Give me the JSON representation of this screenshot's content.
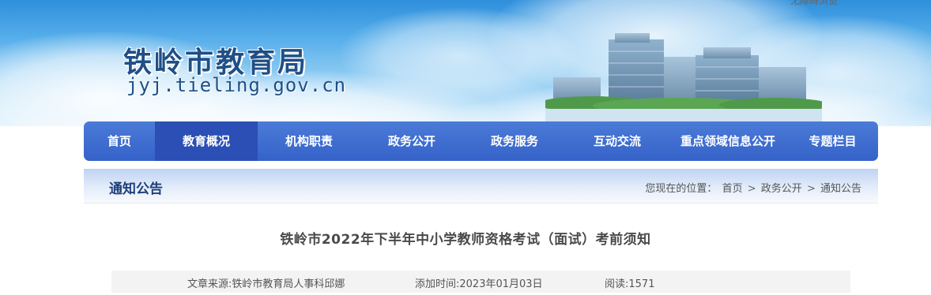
{
  "header": {
    "top_link": "无障碍浏览",
    "site_name": "铁岭市教育局",
    "domain": "jyj.tieling.gov.cn"
  },
  "nav": {
    "items": [
      {
        "label": "首页"
      },
      {
        "label": "教育概况"
      },
      {
        "label": "机构职责"
      },
      {
        "label": "政务公开"
      },
      {
        "label": "政务服务"
      },
      {
        "label": "互动交流"
      },
      {
        "label": "重点领域信息公开"
      },
      {
        "label": "专题栏目"
      }
    ],
    "active_index": 1
  },
  "section": {
    "title": "通知公告",
    "breadcrumb": {
      "prefix": "您现在的位置：",
      "items": [
        "首页",
        "政务公开",
        "通知公告"
      ],
      "separator": ">"
    }
  },
  "article": {
    "title": "铁岭市2022年下半年中小学教师资格考试（面试）考前须知",
    "source": "文章来源:铁岭市教育局人事科邱娜",
    "added_time": "添加时间:2023年01月03日",
    "views": "阅读:1571"
  },
  "colors": {
    "nav_bg": "#3562c8",
    "nav_active": "#2b4fb4",
    "title_blue": "#1f4f86"
  }
}
